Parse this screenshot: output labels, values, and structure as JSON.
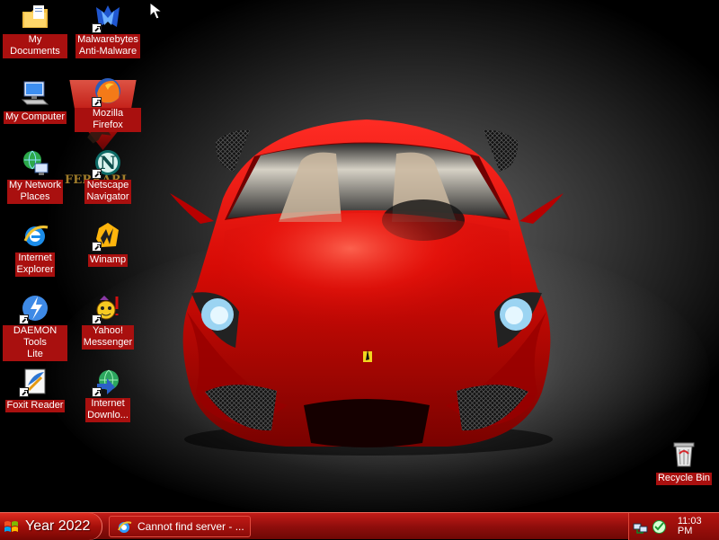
{
  "desktop": {
    "wallpaper_subject": "Red Ferrari F430",
    "wallpaper_text": "FERRARI",
    "icons": [
      {
        "key": "my_documents",
        "label": "My Documents",
        "icon": "folder-documents-icon"
      },
      {
        "key": "malwarebytes",
        "label": "Malwarebytes\nAnti-Malware",
        "icon": "malwarebytes-icon"
      },
      {
        "key": "my_computer",
        "label": "My Computer",
        "icon": "computer-icon"
      },
      {
        "key": "firefox",
        "label": "Mozilla Firefox",
        "icon": "firefox-icon"
      },
      {
        "key": "my_network",
        "label": "My Network\nPlaces",
        "icon": "network-places-icon"
      },
      {
        "key": "netscape",
        "label": "Netscape\nNavigator",
        "icon": "netscape-icon"
      },
      {
        "key": "ie",
        "label": "Internet\nExplorer",
        "icon": "internet-explorer-icon"
      },
      {
        "key": "winamp",
        "label": "Winamp",
        "icon": "winamp-icon"
      },
      {
        "key": "daemon",
        "label": "DAEMON Tools\nLite",
        "icon": "daemon-tools-icon"
      },
      {
        "key": "yahoo",
        "label": "Yahoo!\nMessenger",
        "icon": "yahoo-messenger-icon"
      },
      {
        "key": "foxit",
        "label": "Foxit Reader",
        "icon": "foxit-reader-icon"
      },
      {
        "key": "idm",
        "label": "Internet\nDownlo...",
        "icon": "download-manager-icon"
      },
      {
        "key": "recycle",
        "label": "Recycle Bin",
        "icon": "recycle-bin-icon"
      }
    ]
  },
  "taskbar": {
    "start_label": "Year 2022",
    "active_task": "Cannot find server - ...",
    "clock": "11:03 PM"
  },
  "colors": {
    "accent": "#a9100f",
    "taskbar": "#8f0e0c",
    "car_red": "#d70b05"
  }
}
